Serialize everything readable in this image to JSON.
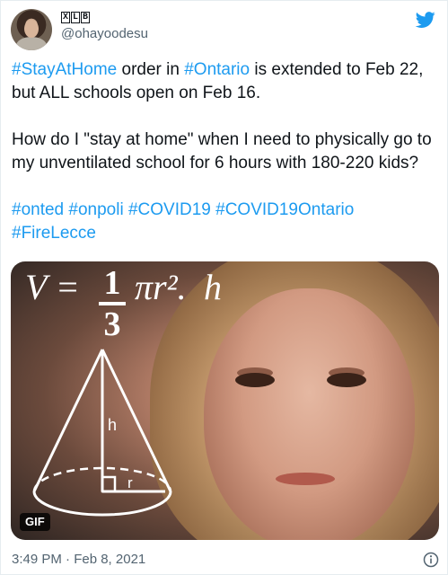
{
  "author": {
    "display_name_chars": [
      "X",
      "L",
      "B"
    ],
    "handle": "@ohayoodesu"
  },
  "tweet": {
    "paragraphs": [
      [
        {
          "text": "#StayAtHome",
          "tag": true
        },
        {
          "text": " order in ",
          "tag": false
        },
        {
          "text": "#Ontario",
          "tag": true
        },
        {
          "text": " is extended to Feb 22, but ALL schools open on Feb 16.",
          "tag": false
        }
      ],
      [
        {
          "text": "How do I \"stay at home\" when I need to physically go to my unventilated school for 6 hours with 180-220 kids?",
          "tag": false
        }
      ],
      [
        {
          "text": "#onted",
          "tag": true
        },
        {
          "text": " ",
          "tag": false
        },
        {
          "text": "#onpoli",
          "tag": true
        },
        {
          "text": " ",
          "tag": false
        },
        {
          "text": "#COVID19",
          "tag": true
        },
        {
          "text": " ",
          "tag": false
        },
        {
          "text": "#COVID19Ontario",
          "tag": true
        },
        {
          "text": " ",
          "tag": false
        },
        {
          "text": "#FireLecce",
          "tag": true
        }
      ]
    ],
    "hashtag_color": "#1d9bf0"
  },
  "media": {
    "formula_v": "V = ",
    "formula_num": "1",
    "formula_den": "3",
    "formula_pi": "πr².",
    "formula_h": "h",
    "cone_h": "h",
    "cone_r": "r",
    "badge": "GIF"
  },
  "meta": {
    "timestamp": "3:49 PM · Feb 8, 2021"
  },
  "icons": {
    "brand": "twitter-bird-icon",
    "info": "info-icon"
  }
}
